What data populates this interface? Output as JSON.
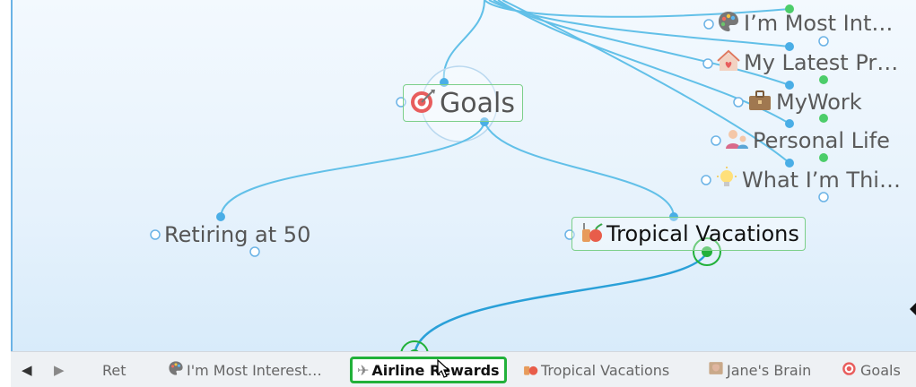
{
  "plex": {
    "active_thought": {
      "label": "Goals",
      "icon": "target-icon"
    },
    "children": [
      {
        "label": "Retiring at 50"
      },
      {
        "label": "Tropical Vacations",
        "icon": "beach-drink-icon"
      }
    ],
    "jumps": [
      {
        "label": "I’m Most Int…",
        "icon": "palette-icon"
      },
      {
        "label": "My Latest Pr…",
        "icon": "home-heart-icon"
      },
      {
        "label": "MyWork",
        "icon": "briefcase-icon"
      },
      {
        "label": "Personal Life",
        "icon": "family-icon"
      },
      {
        "label": "What I’m Thi…",
        "icon": "lightbulb-icon"
      }
    ]
  },
  "history": {
    "back": "◀",
    "forward": "▶",
    "items": [
      {
        "label": "Ret"
      },
      {
        "label": "I'm Most Interest…",
        "icon": "palette-icon"
      },
      {
        "label": "Airline Rewards",
        "icon": "airplane-icon",
        "active": true
      },
      {
        "label": "Tropical Vacations",
        "icon": "beach-drink-icon"
      },
      {
        "label": "Jane's Brain",
        "icon": "brain-icon"
      },
      {
        "label": "Goals",
        "icon": "target-icon"
      }
    ]
  },
  "colors": {
    "link": "#62c0e8",
    "link_dark": "#2aa0d8",
    "selected": "#22b13a",
    "dot_green": "#4ccd6a"
  }
}
